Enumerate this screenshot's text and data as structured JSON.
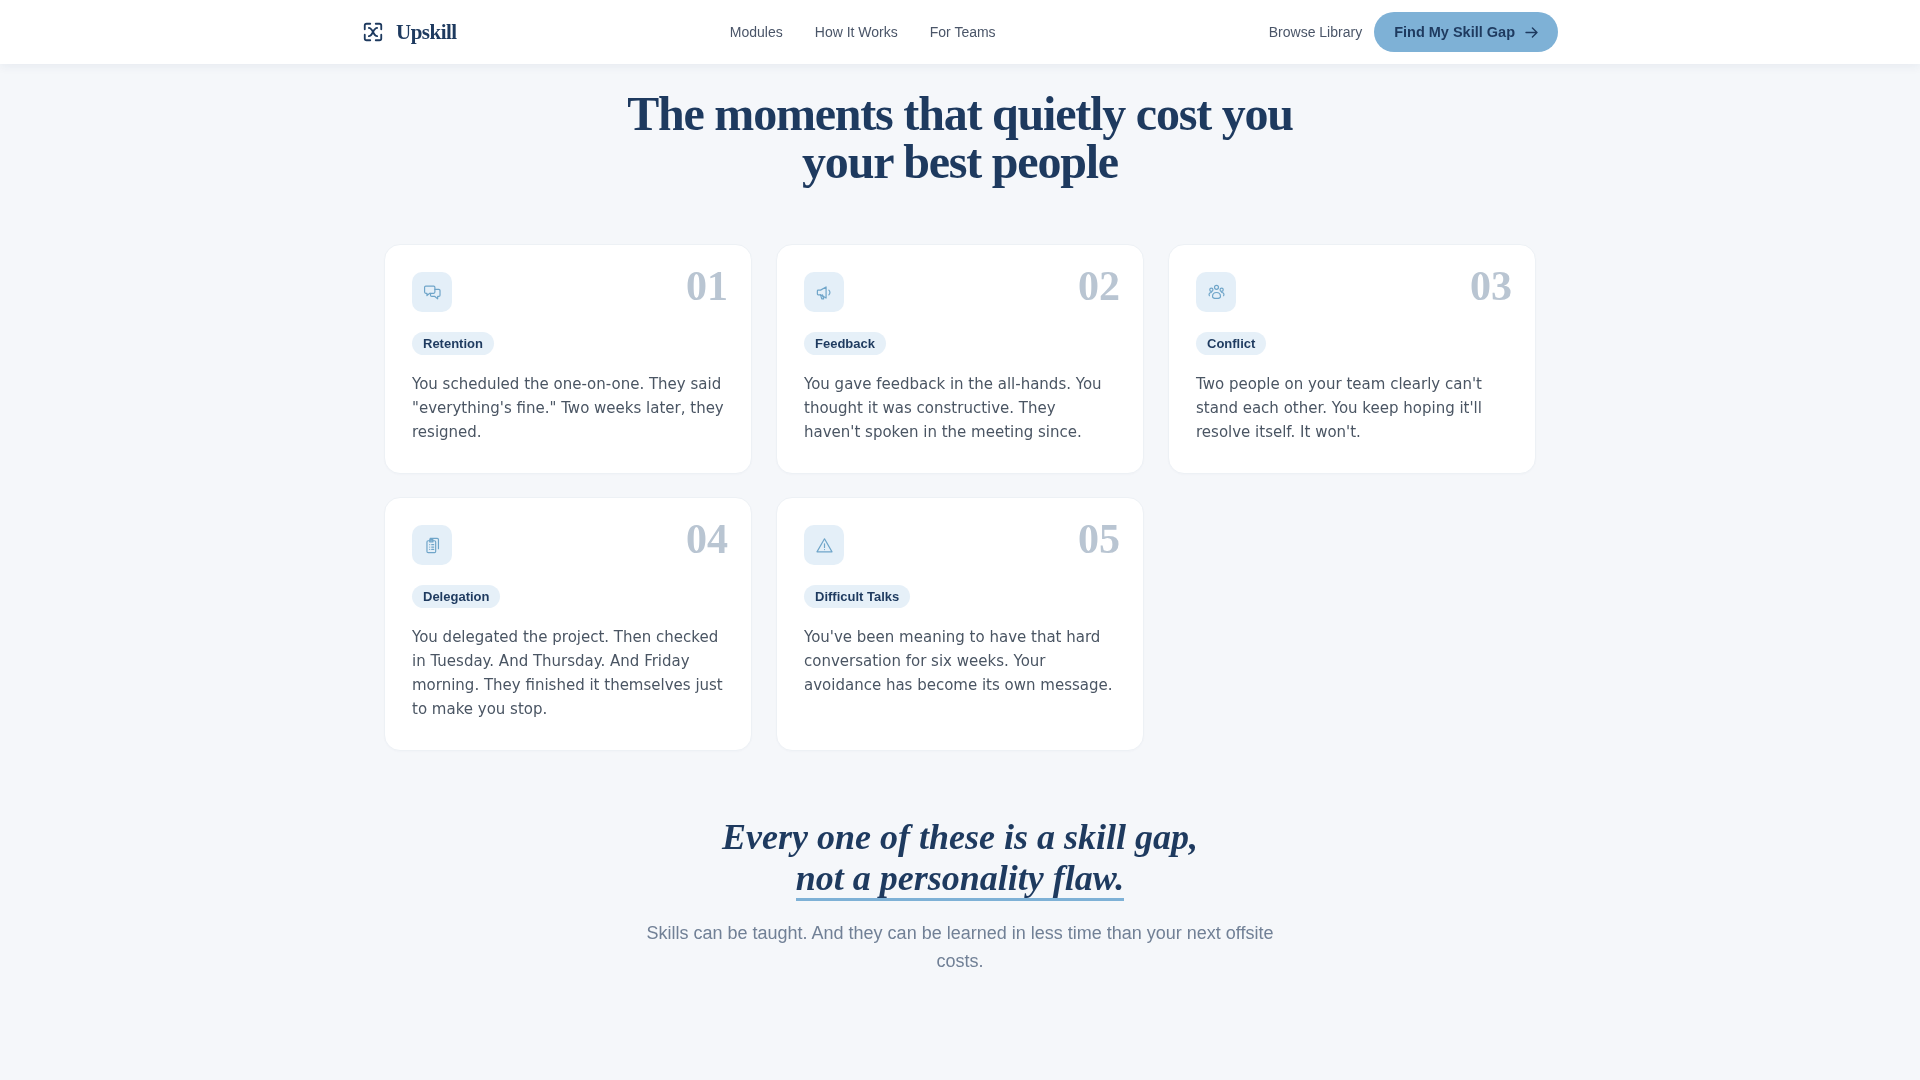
{
  "header": {
    "brand": "Upskill",
    "nav": [
      "Modules",
      "How It Works",
      "For Teams"
    ],
    "secondary_link": "Browse Library",
    "cta": "Find My Skill Gap"
  },
  "section": {
    "title": "The moments that quietly cost you your best people",
    "cards": [
      {
        "number": "01",
        "tag": "Retention",
        "text": "You scheduled the one-on-one. They said \"everything's fine.\" Two weeks later, they resigned."
      },
      {
        "number": "02",
        "tag": "Feedback",
        "text": "You gave feedback in the all-hands. You thought it was constructive. They haven't spoken in the meeting since."
      },
      {
        "number": "03",
        "tag": "Conflict",
        "text": "Two people on your team clearly can't stand each other. You keep hoping it'll resolve itself. It won't."
      },
      {
        "number": "04",
        "tag": "Delegation",
        "text": "You delegated the project. Then checked in Tuesday. And Thursday. And Friday morning. They finished it themselves just to make you stop."
      },
      {
        "number": "05",
        "tag": "Difficult Talks",
        "text": "You've been meaning to have that hard conversation for six weeks. Your avoidance has become its own message."
      }
    ]
  },
  "closing": {
    "headline": "Every one of these is a skill gap,",
    "highlight": "not a personality flaw.",
    "subtitle": "Skills can be taught. And they can be learned in less time than your next offsite costs."
  }
}
